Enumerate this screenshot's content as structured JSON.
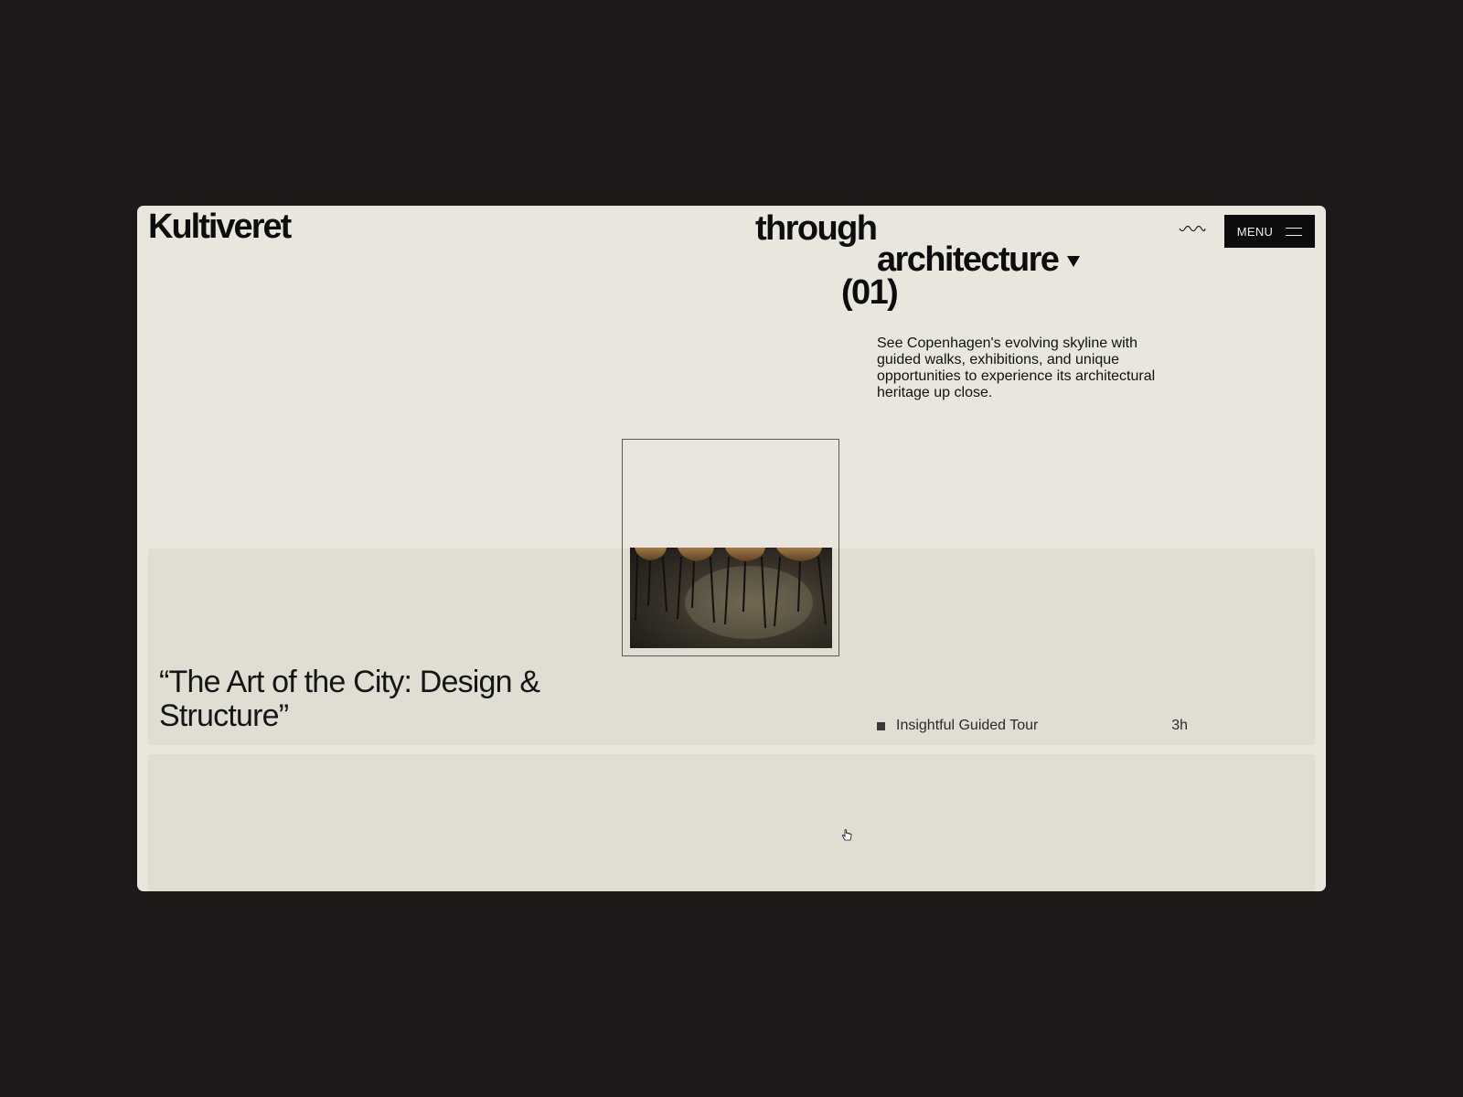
{
  "header": {
    "logo": "Kultiveret",
    "headline_line1": "through",
    "headline_line2": "architecture",
    "headline_index": "(01)",
    "menu_label": "MENU",
    "wave_icon": "wave-icon",
    "menu_icon": "hamburger-icon"
  },
  "intro": {
    "description": "See Copenhagen's evolving skyline with guided walks, exhibitions, and unique opportunities to experience its architectural heritage up close."
  },
  "cards": [
    {
      "title": "“The Art of the City: Design & Structure”",
      "tour_label": "Insightful Guided Tour",
      "tour_duration": "3h"
    }
  ],
  "colors": {
    "page_background": "#1c1918",
    "window_background": "#e9e7dd",
    "card_background": "#e0ddd2",
    "menu_button": "#0c0c0c"
  }
}
